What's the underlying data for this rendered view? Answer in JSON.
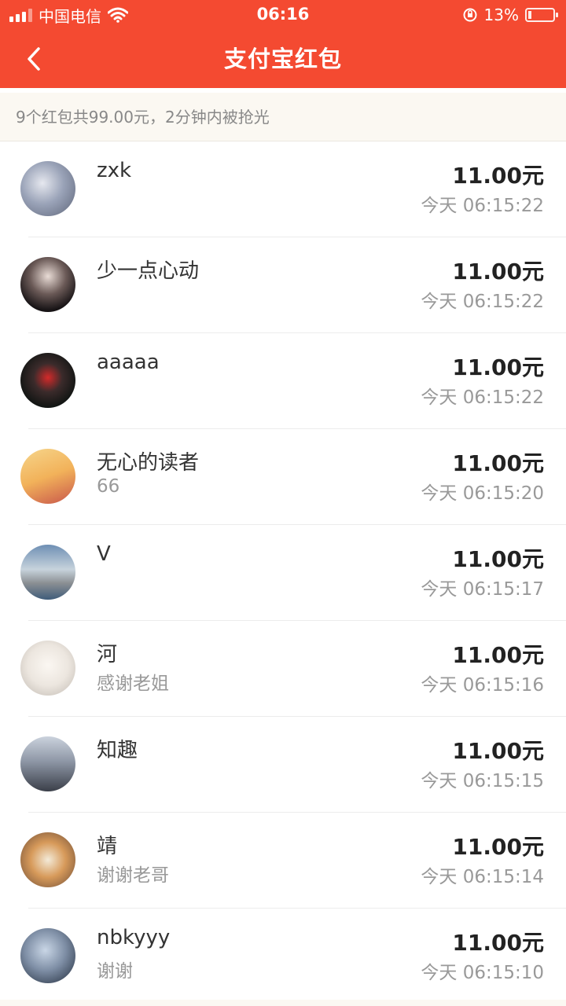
{
  "status_bar": {
    "carrier": "中国电信",
    "time": "06:16",
    "battery_percent": "13%",
    "battery_level": 0.13,
    "icons": [
      "signal-icon",
      "wifi-icon",
      "orientation-lock-icon",
      "battery-icon"
    ]
  },
  "nav": {
    "title": "支付宝红包",
    "back_icon": "chevron-left-icon"
  },
  "summary": {
    "text": "9个红包共99.00元，2分钟内被抢光"
  },
  "colors": {
    "header": "#f44a31",
    "summary_bg": "#fbf8f2"
  },
  "records": [
    {
      "name": "zxk",
      "note": "",
      "amount": "11.00元",
      "time": "今天 06:15:22"
    },
    {
      "name": "少一点心动",
      "note": "",
      "amount": "11.00元",
      "time": "今天 06:15:22"
    },
    {
      "name": "aaaaa",
      "note": "",
      "amount": "11.00元",
      "time": "今天 06:15:22"
    },
    {
      "name": "无心的读者",
      "note": "66",
      "amount": "11.00元",
      "time": "今天 06:15:20"
    },
    {
      "name": "V",
      "note": "",
      "amount": "11.00元",
      "time": "今天 06:15:17"
    },
    {
      "name": "河",
      "note": "感谢老姐",
      "amount": "11.00元",
      "time": "今天 06:15:16"
    },
    {
      "name": "知趣",
      "note": "",
      "amount": "11.00元",
      "time": "今天 06:15:15"
    },
    {
      "name": "靖",
      "note": "谢谢老哥",
      "amount": "11.00元",
      "time": "今天 06:15:14"
    },
    {
      "name": "nbkyyy",
      "note": "谢谢",
      "amount": "11.00元",
      "time": "今天 06:15:10"
    }
  ]
}
